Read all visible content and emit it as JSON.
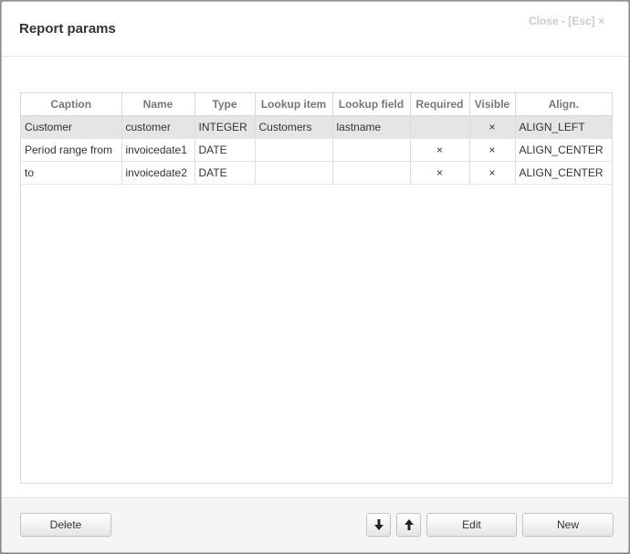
{
  "dialog": {
    "title": "Report params",
    "close_label": "Close - [Esc] ×"
  },
  "table": {
    "columns": [
      "Caption",
      "Name",
      "Type",
      "Lookup item",
      "Lookup field",
      "Required",
      "Visible",
      "Align."
    ],
    "rows": [
      [
        "Customer",
        "customer",
        "INTEGER",
        "Customers",
        "lastname",
        "",
        "×",
        "ALIGN_LEFT"
      ],
      [
        "Period range from",
        "invoicedate1",
        "DATE",
        "",
        "",
        "×",
        "×",
        "ALIGN_CENTER"
      ],
      [
        "to",
        "invoicedate2",
        "DATE",
        "",
        "",
        "×",
        "×",
        "ALIGN_CENTER"
      ]
    ],
    "selected_row": 0
  },
  "footer": {
    "delete_label": "Delete",
    "move_down_icon": "arrow-down-icon",
    "move_up_icon": "arrow-up-icon",
    "edit_label": "Edit",
    "new_label": "New"
  },
  "colors": {
    "selected_row": "#e5e5e5",
    "footer_background": "#f5f5f5",
    "header_text": "#777777",
    "close_text": "#cccccc"
  }
}
